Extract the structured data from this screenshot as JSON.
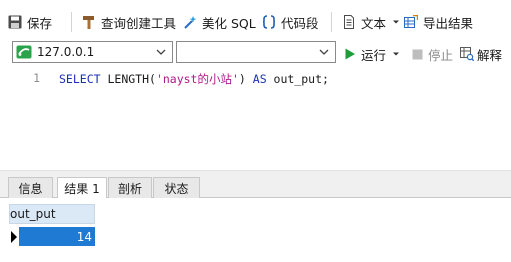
{
  "toolbar": {
    "save_label": "保存",
    "query_builder_label": "查询创建工具",
    "beautify_label": "美化 SQL",
    "snippet_label": "代码段",
    "text_label": "文本",
    "export_label": "导出结果"
  },
  "connection": {
    "selected": "127.0.0.1",
    "database_selected": ""
  },
  "run_controls": {
    "run_label": "运行",
    "stop_label": "停止",
    "explain_label": "解释"
  },
  "editor": {
    "line_number": "1",
    "code": {
      "kw_select": "SELECT",
      "func": " LENGTH(",
      "string_literal": "'nayst的小站'",
      "close_paren": ")",
      "kw_as": " AS",
      "alias": " out_put;"
    }
  },
  "tabs": [
    {
      "label": "信息"
    },
    {
      "label": "结果 1"
    },
    {
      "label": "剖析"
    },
    {
      "label": "状态"
    }
  ],
  "active_tab": "结果 1",
  "results": {
    "columns": [
      "out_put"
    ],
    "rows": [
      [
        "14"
      ]
    ]
  },
  "colors": {
    "selection": "#1e7ad2",
    "header_bg": "#dbe9f7",
    "run_green": "#1f9d3a",
    "keyword": "#1b2fb5",
    "string": "#b0198a"
  },
  "icons": [
    "save-icon",
    "hammer-icon",
    "magic-wand-icon",
    "braces-icon",
    "document-icon",
    "export-grid-icon",
    "connection-icon",
    "chevron-down-icon",
    "play-icon",
    "stop-icon",
    "explain-icon",
    "row-pointer-icon"
  ]
}
